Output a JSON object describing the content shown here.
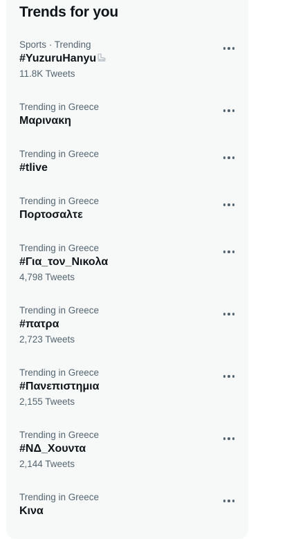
{
  "panel": {
    "title": "Trends for you"
  },
  "trends": [
    {
      "meta": "Sports · Trending",
      "name": "#YuzuruHanyu",
      "count": "11.8K Tweets",
      "emoji_icon": "ice-skate-icon"
    },
    {
      "meta": "Trending in Greece",
      "name": "Μαρινακη",
      "count": ""
    },
    {
      "meta": "Trending in Greece",
      "name": "#tlive",
      "count": ""
    },
    {
      "meta": "Trending in Greece",
      "name": "Πορτοσαλτε",
      "count": ""
    },
    {
      "meta": "Trending in Greece",
      "name": "#Για_τον_Νικολα",
      "count": "4,798 Tweets"
    },
    {
      "meta": "Trending in Greece",
      "name": "#πατρα",
      "count": "2,723 Tweets"
    },
    {
      "meta": "Trending in Greece",
      "name": "#Πανεπιστημια",
      "count": "2,155 Tweets"
    },
    {
      "meta": "Trending in Greece",
      "name": "#ΝΔ_Χουντα",
      "count": "2,144 Tweets"
    },
    {
      "meta": "Trending in Greece",
      "name": "Κινα",
      "count": ""
    }
  ],
  "colors": {
    "panel_bg": "#f7f9f9",
    "primary_text": "#0f1419",
    "secondary_text": "#536471"
  }
}
